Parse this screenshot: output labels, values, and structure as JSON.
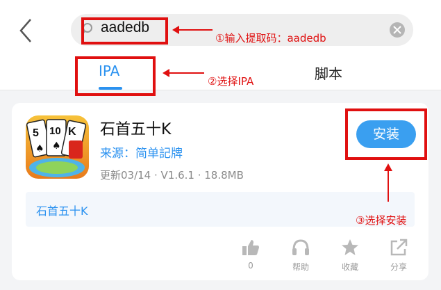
{
  "search": {
    "query": "aadedb"
  },
  "tabs": [
    {
      "label": "IPA",
      "active": true
    },
    {
      "label": "脚本",
      "active": false
    }
  ],
  "app": {
    "name": "石首五十K",
    "source": "来源：简单記牌",
    "meta": "更新03/14 · V1.6.1 · 18.8MB",
    "install_label": "安装",
    "description": "石首五十K"
  },
  "actions": [
    {
      "icon": "thumbs-up-icon",
      "label": "0"
    },
    {
      "icon": "headphones-icon",
      "label": "帮助"
    },
    {
      "icon": "star-icon",
      "label": "收藏"
    },
    {
      "icon": "share-icon",
      "label": "分享"
    }
  ],
  "annotations": {
    "step1": "①输入提取码：aadedb",
    "step2": "②选择IPA",
    "step3": "③选择安装"
  },
  "colors": {
    "accent": "#2b92f0",
    "install_button": "#3a9ff0",
    "annotation": "#e01010"
  }
}
